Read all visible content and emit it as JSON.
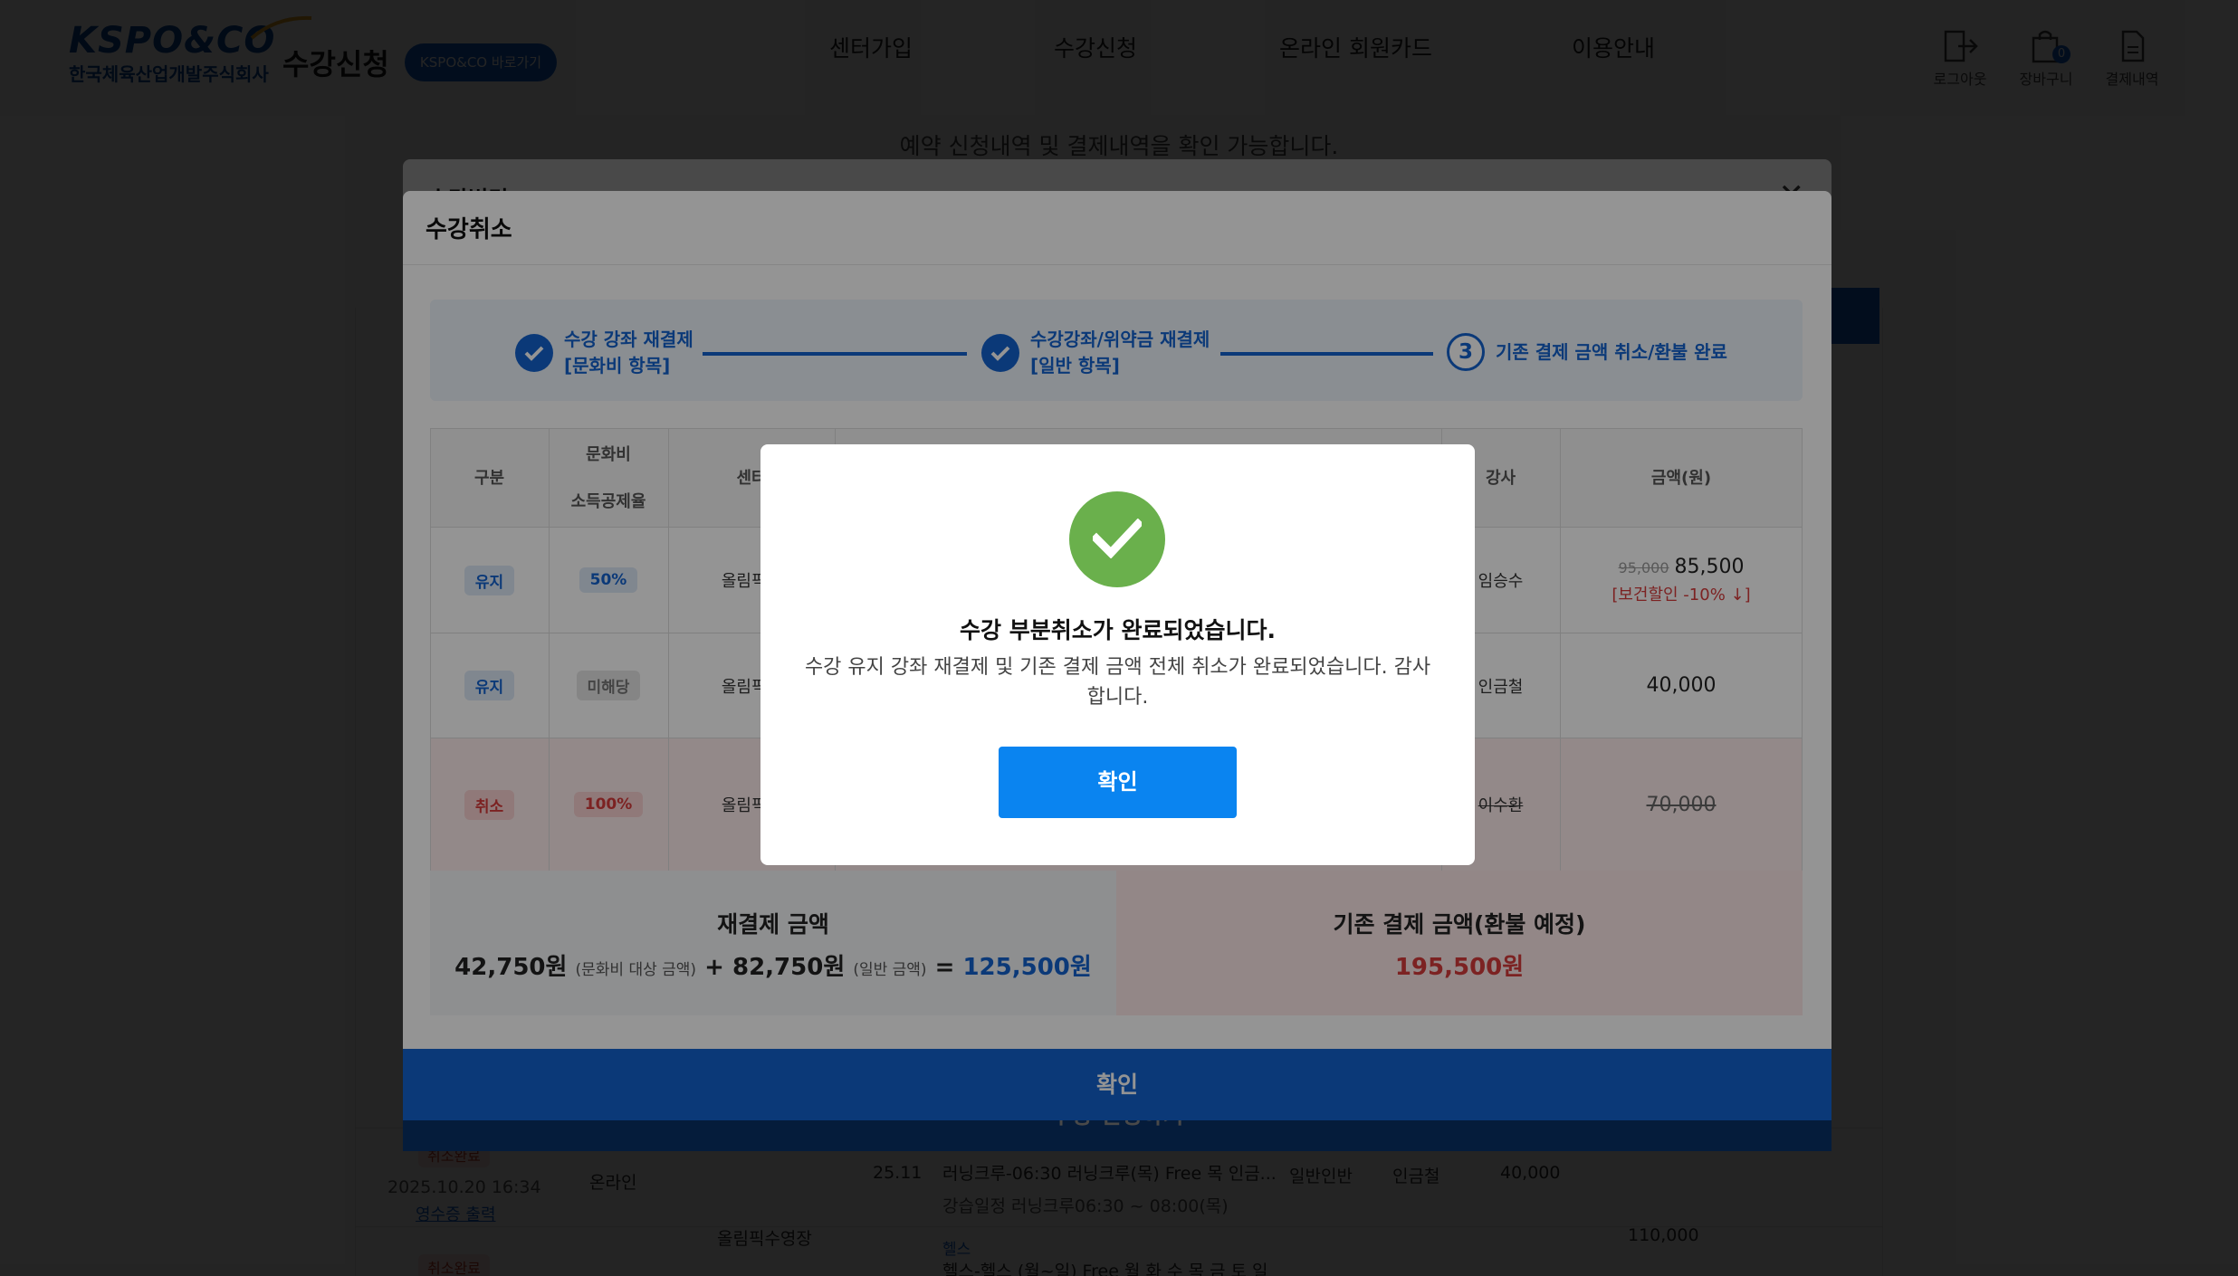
{
  "header": {
    "logo_text": "KSPO&CO",
    "logo_sub": "한국체육산업개발주식회사",
    "site_title": "수강신청",
    "badge": "KSPO&CO 바로가기",
    "nav": [
      "센터가입",
      "수강신청",
      "온라인 회원카드",
      "이용안내"
    ],
    "utils": [
      {
        "label": "로그아웃",
        "icon": "logout-icon"
      },
      {
        "label": "장바구니",
        "icon": "cart-icon",
        "count": "0"
      },
      {
        "label": "결제내역",
        "icon": "document-icon"
      }
    ]
  },
  "page": {
    "description": "예약 신청내역 및 결제내역을 확인 가능합니다.",
    "rows": [
      {
        "date": "2025.10.20 16:34",
        "receipt": "영수증 출력",
        "type": "온라인",
        "month": "25.11",
        "course": "러닝크루-06:30 러닝크루(목) Free 목 인금...",
        "category": "일반인반",
        "teacher": "인금철",
        "amount": "40,000",
        "course_sub": "강습일정  러닝크루06:30 ~ 08:00(목)"
      },
      {
        "center": "올림픽수영장",
        "total": "110,000",
        "tag1": "취소완료",
        "tag2": "취소완료",
        "course2_cat": "헬스",
        "course2": "헬스-헬스 (월~일) Free 월 화 수 목 금 토 일"
      }
    ]
  },
  "change_modal": {
    "title": "수강변경",
    "close_icon": "close-icon",
    "footer_label": "수강 변경하기"
  },
  "cancel_modal": {
    "title": "수강취소",
    "steps": [
      {
        "line1": "수강 강좌 재결제",
        "line2": "[문화비 항목]",
        "state": "done"
      },
      {
        "line1": "수강강좌/위약금 재결제",
        "line2": "[일반 항목]",
        "state": "done"
      },
      {
        "num": "3",
        "line1": "기존 결제 금액 취소/환불 완료",
        "state": "current"
      }
    ],
    "table": {
      "headers": {
        "type": "구분",
        "rate_l1": "문화비",
        "rate_l2": "소득공제율",
        "center": "센터",
        "teacher": "강사",
        "amount": "금액(원)"
      },
      "rows": [
        {
          "status": "유지",
          "status_kind": "keep",
          "rate": "50%",
          "rate_kind": "rate",
          "center": "올림픽수",
          "teacher": "임승수",
          "orig_amount": "95,000",
          "amount": "85,500",
          "discount": "[보건할인 -10% ↓]"
        },
        {
          "status": "유지",
          "status_kind": "keep",
          "rate": "미해당",
          "rate_kind": "na",
          "center": "올림픽수",
          "teacher": "인금철",
          "amount": "40,000"
        },
        {
          "status": "취소",
          "status_kind": "cancel",
          "rate": "100%",
          "rate_kind": "cancel",
          "center": "올림픽수",
          "teacher": "이수환",
          "amount": "70,000"
        }
      ]
    },
    "summary": {
      "repay_title": "재결제 금액",
      "culture_amount": "42,750원",
      "culture_note": "(문화비 대상 금액)",
      "plus": "+",
      "general_amount": "82,750원",
      "general_note": "(일반 금액)",
      "equals": "=",
      "repay_total": "125,500원",
      "refund_title": "기존 결제 금액(환불 예정)",
      "refund_total": "195,500원"
    },
    "footer_label": "확인"
  },
  "alert": {
    "icon": "check-circle-icon",
    "title": "수강 부분취소가 완료되었습니다.",
    "message": "수강 유지 강좌 재결제 및 기존 결제 금액 전체 취소가 완료되었습니다. 감사합니다.",
    "confirm_label": "확인"
  },
  "colors": {
    "primary": "#1463cf",
    "alert_button": "#0a84f0",
    "success": "#6ab04c",
    "danger": "#d63b3b"
  }
}
